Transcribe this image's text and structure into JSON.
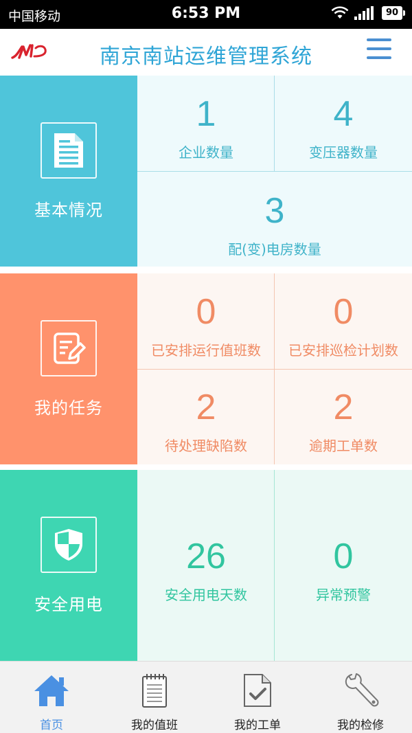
{
  "status_bar": {
    "carrier": "中国移动",
    "time": "6:53 PM",
    "battery": "90"
  },
  "header": {
    "title": "南京南站运维管理系统"
  },
  "sections": {
    "basic": {
      "label": "基本情况",
      "stats": [
        {
          "value": "1",
          "label": "企业数量"
        },
        {
          "value": "4",
          "label": "变压器数量"
        },
        {
          "value": "3",
          "label": "配(变)电房数量"
        }
      ]
    },
    "task": {
      "label": "我的任务",
      "stats": [
        {
          "value": "0",
          "label": "已安排运行值班数"
        },
        {
          "value": "0",
          "label": "已安排巡检计划数"
        },
        {
          "value": "2",
          "label": "待处理缺陷数"
        },
        {
          "value": "2",
          "label": "逾期工单数"
        }
      ]
    },
    "safe": {
      "label": "安全用电",
      "stats": [
        {
          "value": "26",
          "label": "安全用电天数"
        },
        {
          "value": "0",
          "label": "异常预警"
        }
      ]
    }
  },
  "bottom_nav": [
    {
      "label": "首页",
      "icon": "home-icon",
      "active": true
    },
    {
      "label": "我的值班",
      "icon": "notepad-icon",
      "active": false
    },
    {
      "label": "我的工单",
      "icon": "document-check-icon",
      "active": false
    },
    {
      "label": "我的检修",
      "icon": "wrench-icon",
      "active": false
    }
  ],
  "colors": {
    "basic": "#4fc5da",
    "task": "#ff926c",
    "safe": "#3ed6b2",
    "title": "#2fa5d6",
    "nav_active": "#4a90e2"
  }
}
